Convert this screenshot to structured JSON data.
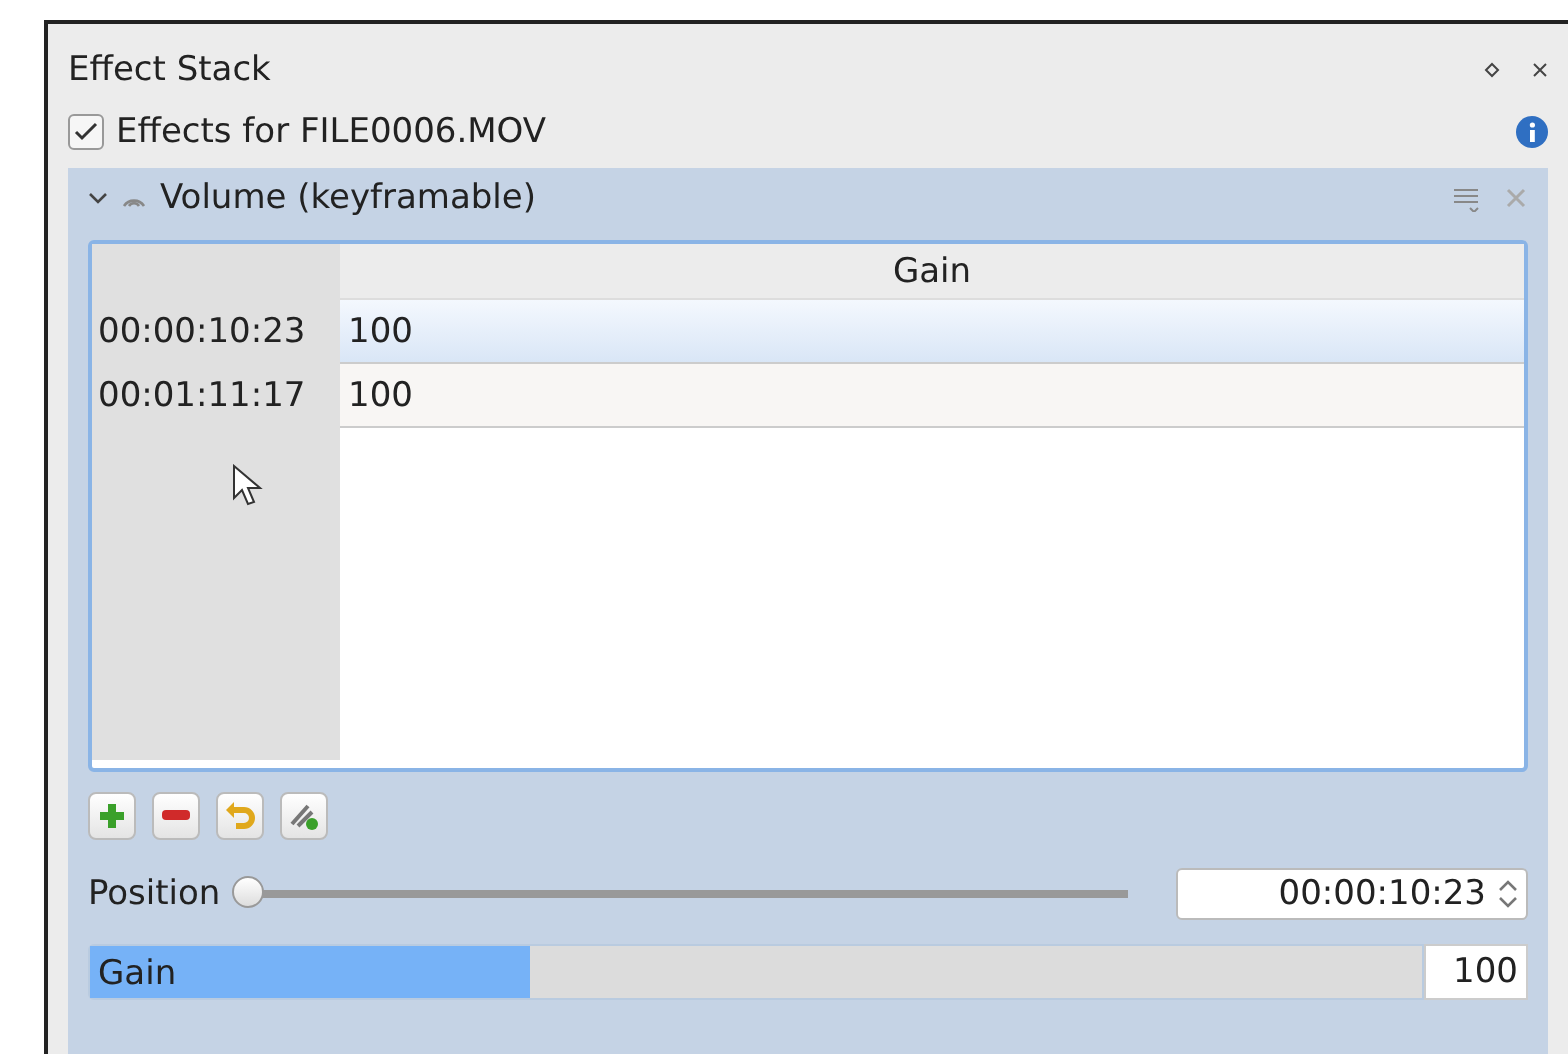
{
  "panel": {
    "title": "Effect Stack"
  },
  "effects_toggle": {
    "label": "Effects for FILE0006.MOV",
    "checked": true
  },
  "effect": {
    "name": "Volume (keyframable)",
    "expanded": true,
    "table": {
      "columns": [
        "Gain"
      ],
      "rows": [
        {
          "time": "00:00:10:23",
          "value": "100",
          "selected": true
        },
        {
          "time": "00:01:11:17",
          "value": "100",
          "selected": false
        }
      ]
    },
    "position": {
      "label": "Position",
      "level": 0.0,
      "value": "00:00:10:23"
    },
    "gain": {
      "label": "Gain",
      "level": 0.33,
      "value": "100"
    }
  }
}
